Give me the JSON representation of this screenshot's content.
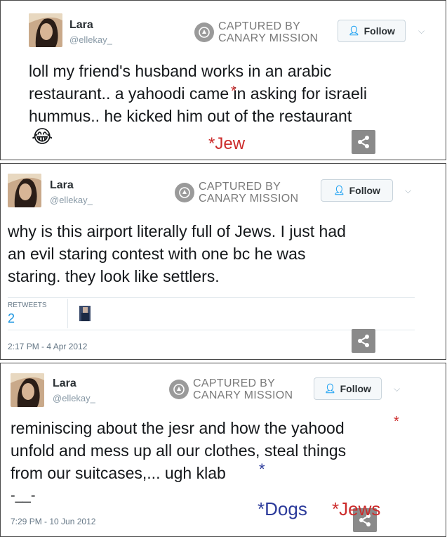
{
  "brand": {
    "captured_line1": "CAPTURED BY",
    "captured_line2": "CANARY MISSION"
  },
  "colors": {
    "annotation_red": "#cc2b2b",
    "annotation_blue": "#2b3a9a",
    "follow_icon": "#1da1f2"
  },
  "tweets": [
    {
      "name": "Lara",
      "handle": "@ellekay_",
      "follow_label": "Follow",
      "lines": [
        "loll my friend's husband works in an arabic",
        "restaurant.. a yahoodi came in asking for israeli",
        "hummus.. he kicked him out of the restaurant"
      ],
      "emoji": "😂",
      "annotation": "*Jew"
    },
    {
      "name": "Lara",
      "handle": "@ellekay_",
      "follow_label": "Follow",
      "lines": [
        "why is this airport literally full of Jews. I just had",
        "an evil staring contest with one bc he was",
        "staring. they look like settlers."
      ],
      "retweets_label": "RETWEETS",
      "retweets_count": "2",
      "timestamp": "2:17 PM - 4 Apr 2012"
    },
    {
      "name": "Lara",
      "handle": "@ellekay_",
      "follow_label": "Follow",
      "lines": [
        "reminiscing about the jesr and how the yahood",
        "unfold and mess up all our clothes, steal things",
        "from our suitcases,... ugh klab",
        "-__-"
      ],
      "annotation_blue": "*Dogs",
      "annotation_red": "*Jews",
      "timestamp": "7:29 PM - 10 Jun 2012"
    }
  ]
}
